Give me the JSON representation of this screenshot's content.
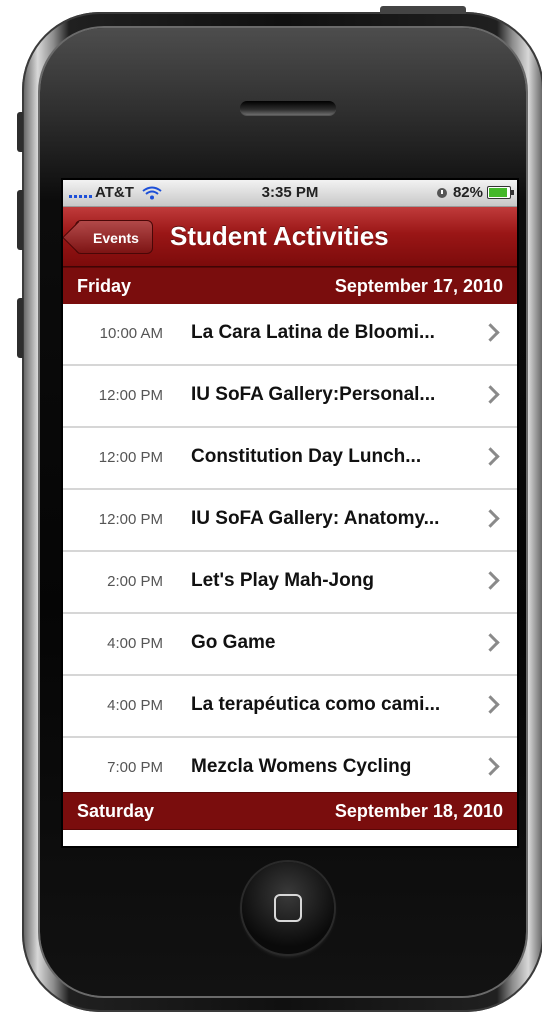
{
  "status_bar": {
    "carrier": "AT&T",
    "time": "3:35 PM",
    "battery": "82%",
    "battery_level": 0.82
  },
  "nav": {
    "back_label": "Events",
    "title": "Student Activities"
  },
  "sections": [
    {
      "day": "Friday",
      "date": "September 17, 2010",
      "events": [
        {
          "time": "10:00 AM",
          "title": "La Cara Latina de Bloomi..."
        },
        {
          "time": "12:00 PM",
          "title": "IU SoFA Gallery:Personal..."
        },
        {
          "time": "12:00 PM",
          "title": "Constitution Day Lunch..."
        },
        {
          "time": "12:00 PM",
          "title": "IU SoFA Gallery: Anatomy..."
        },
        {
          "time": "2:00 PM",
          "title": "Let's Play Mah-Jong"
        },
        {
          "time": "4:00 PM",
          "title": "Go Game"
        },
        {
          "time": "4:00 PM",
          "title": "La terapéutica como cami..."
        },
        {
          "time": "7:00 PM",
          "title": "Mezcla Womens Cycling"
        }
      ]
    },
    {
      "day": "Saturday",
      "date": "September 18, 2010",
      "events": []
    }
  ],
  "colors": {
    "nav_red": "#9a1616",
    "section_red": "#7a0d0d",
    "battery_green": "#44b82a"
  }
}
